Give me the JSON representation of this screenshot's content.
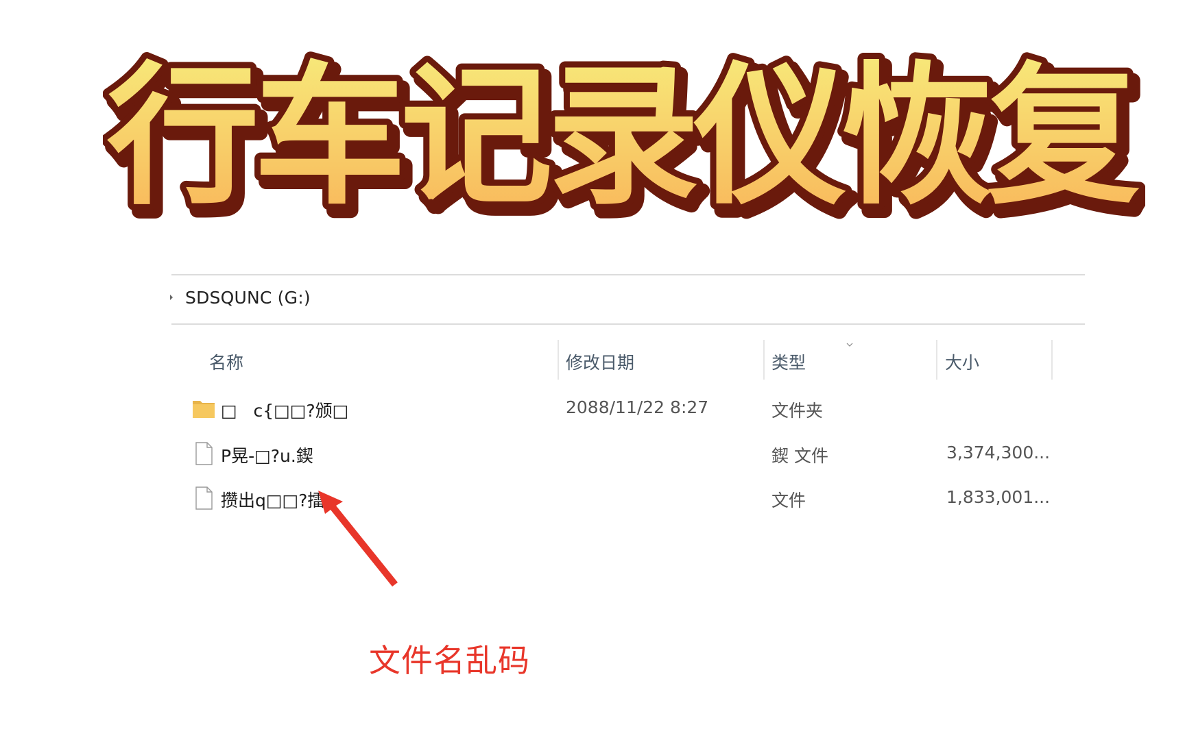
{
  "headline": {
    "text": "行车记录仪恢复",
    "fill_top": "#f7ea7a",
    "fill_bottom": "#f9b65a",
    "outline": "#6a1a0c"
  },
  "address_bar": {
    "drive_label": "SDSQUNC (G:)"
  },
  "columns": {
    "name": "名称",
    "modified": "修改日期",
    "type": "类型",
    "size": "大小"
  },
  "files": [
    {
      "icon": "folder-icon",
      "name": "□   c{□□?颁□",
      "modified": "2088/11/22 8:27",
      "type": "文件夹",
      "size": ""
    },
    {
      "icon": "file-icon",
      "name": "P晃-□?u.鍥",
      "modified": "",
      "type": "鍥 文件",
      "size": "3,374,300..."
    },
    {
      "icon": "file-icon",
      "name": "攒出q□□?擂",
      "modified": "",
      "type": "文件",
      "size": "1,833,001..."
    }
  ],
  "annotation": {
    "text": "文件名乱码",
    "color": "#e8362a",
    "icon": "arrow-icon"
  },
  "colors": {
    "folder": "#f6c85f",
    "header_text": "#4a5a6a",
    "divider": "#dcdcdc"
  }
}
